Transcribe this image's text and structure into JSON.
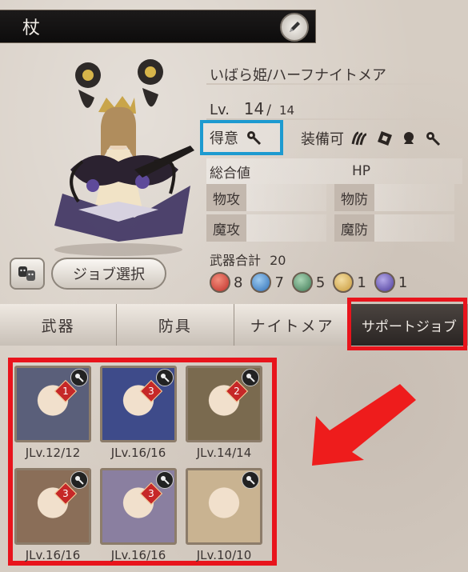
{
  "topbar": {
    "title": "杖"
  },
  "character": {
    "name": "いばら姫/ハーフナイトメア",
    "level_label": "Lv.",
    "level": "14",
    "level_sep": "/",
    "level_max": "14"
  },
  "fav": {
    "label": "得意"
  },
  "equip": {
    "label": "装備可"
  },
  "stats": {
    "total_label": "総合値",
    "hp_label": "HP",
    "phys_atk": "物攻",
    "phys_def": "物防",
    "mag_atk": "魔攻",
    "mag_def": "魔防"
  },
  "weapons": {
    "total_label": "武器合計",
    "total": "20",
    "orbs": [
      {
        "color": "#c0302a",
        "count": "8"
      },
      {
        "color": "#2f6fb7",
        "count": "7"
      },
      {
        "color": "#3f7a56",
        "count": "5"
      },
      {
        "color": "#c89a3a",
        "count": "1"
      },
      {
        "color": "#4b3a9a",
        "count": "1"
      }
    ]
  },
  "buttons": {
    "job_select": "ジョブ選択"
  },
  "tabs": [
    {
      "label": "武器"
    },
    {
      "label": "防具"
    },
    {
      "label": "ナイトメア"
    },
    {
      "label": "サポートジョブ"
    }
  ],
  "jobs": [
    {
      "jlv": "JLv.12/12",
      "rank": "1",
      "color": "#5a5f7a"
    },
    {
      "jlv": "JLv.16/16",
      "rank": "3",
      "color": "#3e4b8a"
    },
    {
      "jlv": "JLv.14/14",
      "rank": "2",
      "color": "#7a6a4f"
    },
    {
      "jlv": "JLv.16/16",
      "rank": "3",
      "color": "#8a6e58"
    },
    {
      "jlv": "JLv.16/16",
      "rank": "3",
      "color": "#8a7fa0"
    },
    {
      "jlv": "JLv.10/10",
      "rank": "",
      "color": "#c9b391"
    }
  ],
  "colors": {
    "highlight_red": "#e8141c",
    "highlight_blue": "#1d9ad0"
  }
}
